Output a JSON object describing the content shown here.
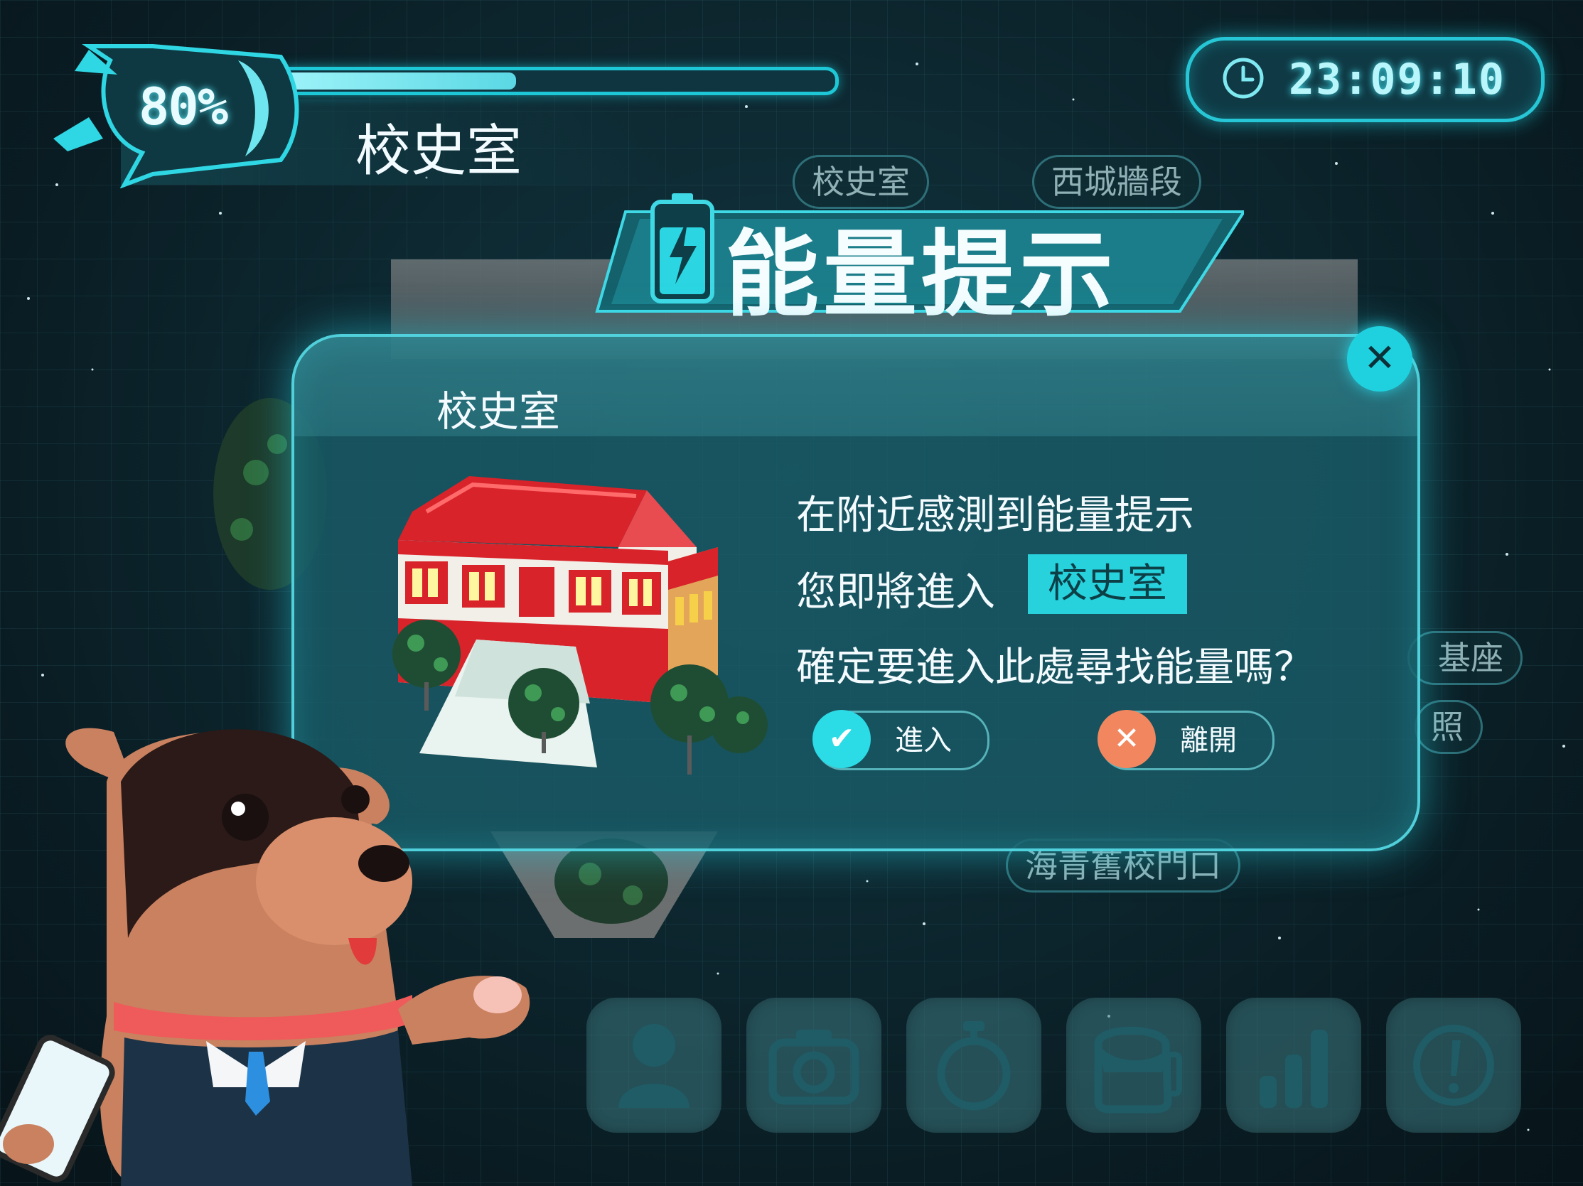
{
  "energy": {
    "percent_label": "80%",
    "level": 0.8,
    "location": "校史室"
  },
  "clock": {
    "time": "23:09:10"
  },
  "background_chips": [
    "校史室",
    "西城牆段",
    "海青舊校門口",
    "基座",
    "照"
  ],
  "banner": {
    "title": "能量提示",
    "icon": "battery-charging-icon"
  },
  "dialog": {
    "title": "校史室",
    "line1": "在附近感測到能量提示",
    "line2_prefix": "您即將進入",
    "target": "校史室",
    "line3": "確定要進入此處尋找能量嗎？",
    "enter_label": "進入",
    "leave_label": "離開",
    "close_icon": "close-icon"
  },
  "toolbar": [
    {
      "icon": "profile-icon"
    },
    {
      "icon": "camera-icon"
    },
    {
      "icon": "stopwatch-icon"
    },
    {
      "icon": "backpack-icon"
    },
    {
      "icon": "stats-icon"
    },
    {
      "icon": "info-icon"
    }
  ],
  "colors": {
    "accent": "#1fd1df",
    "leave": "#f2875f",
    "dialog_bg": "#195a66"
  }
}
